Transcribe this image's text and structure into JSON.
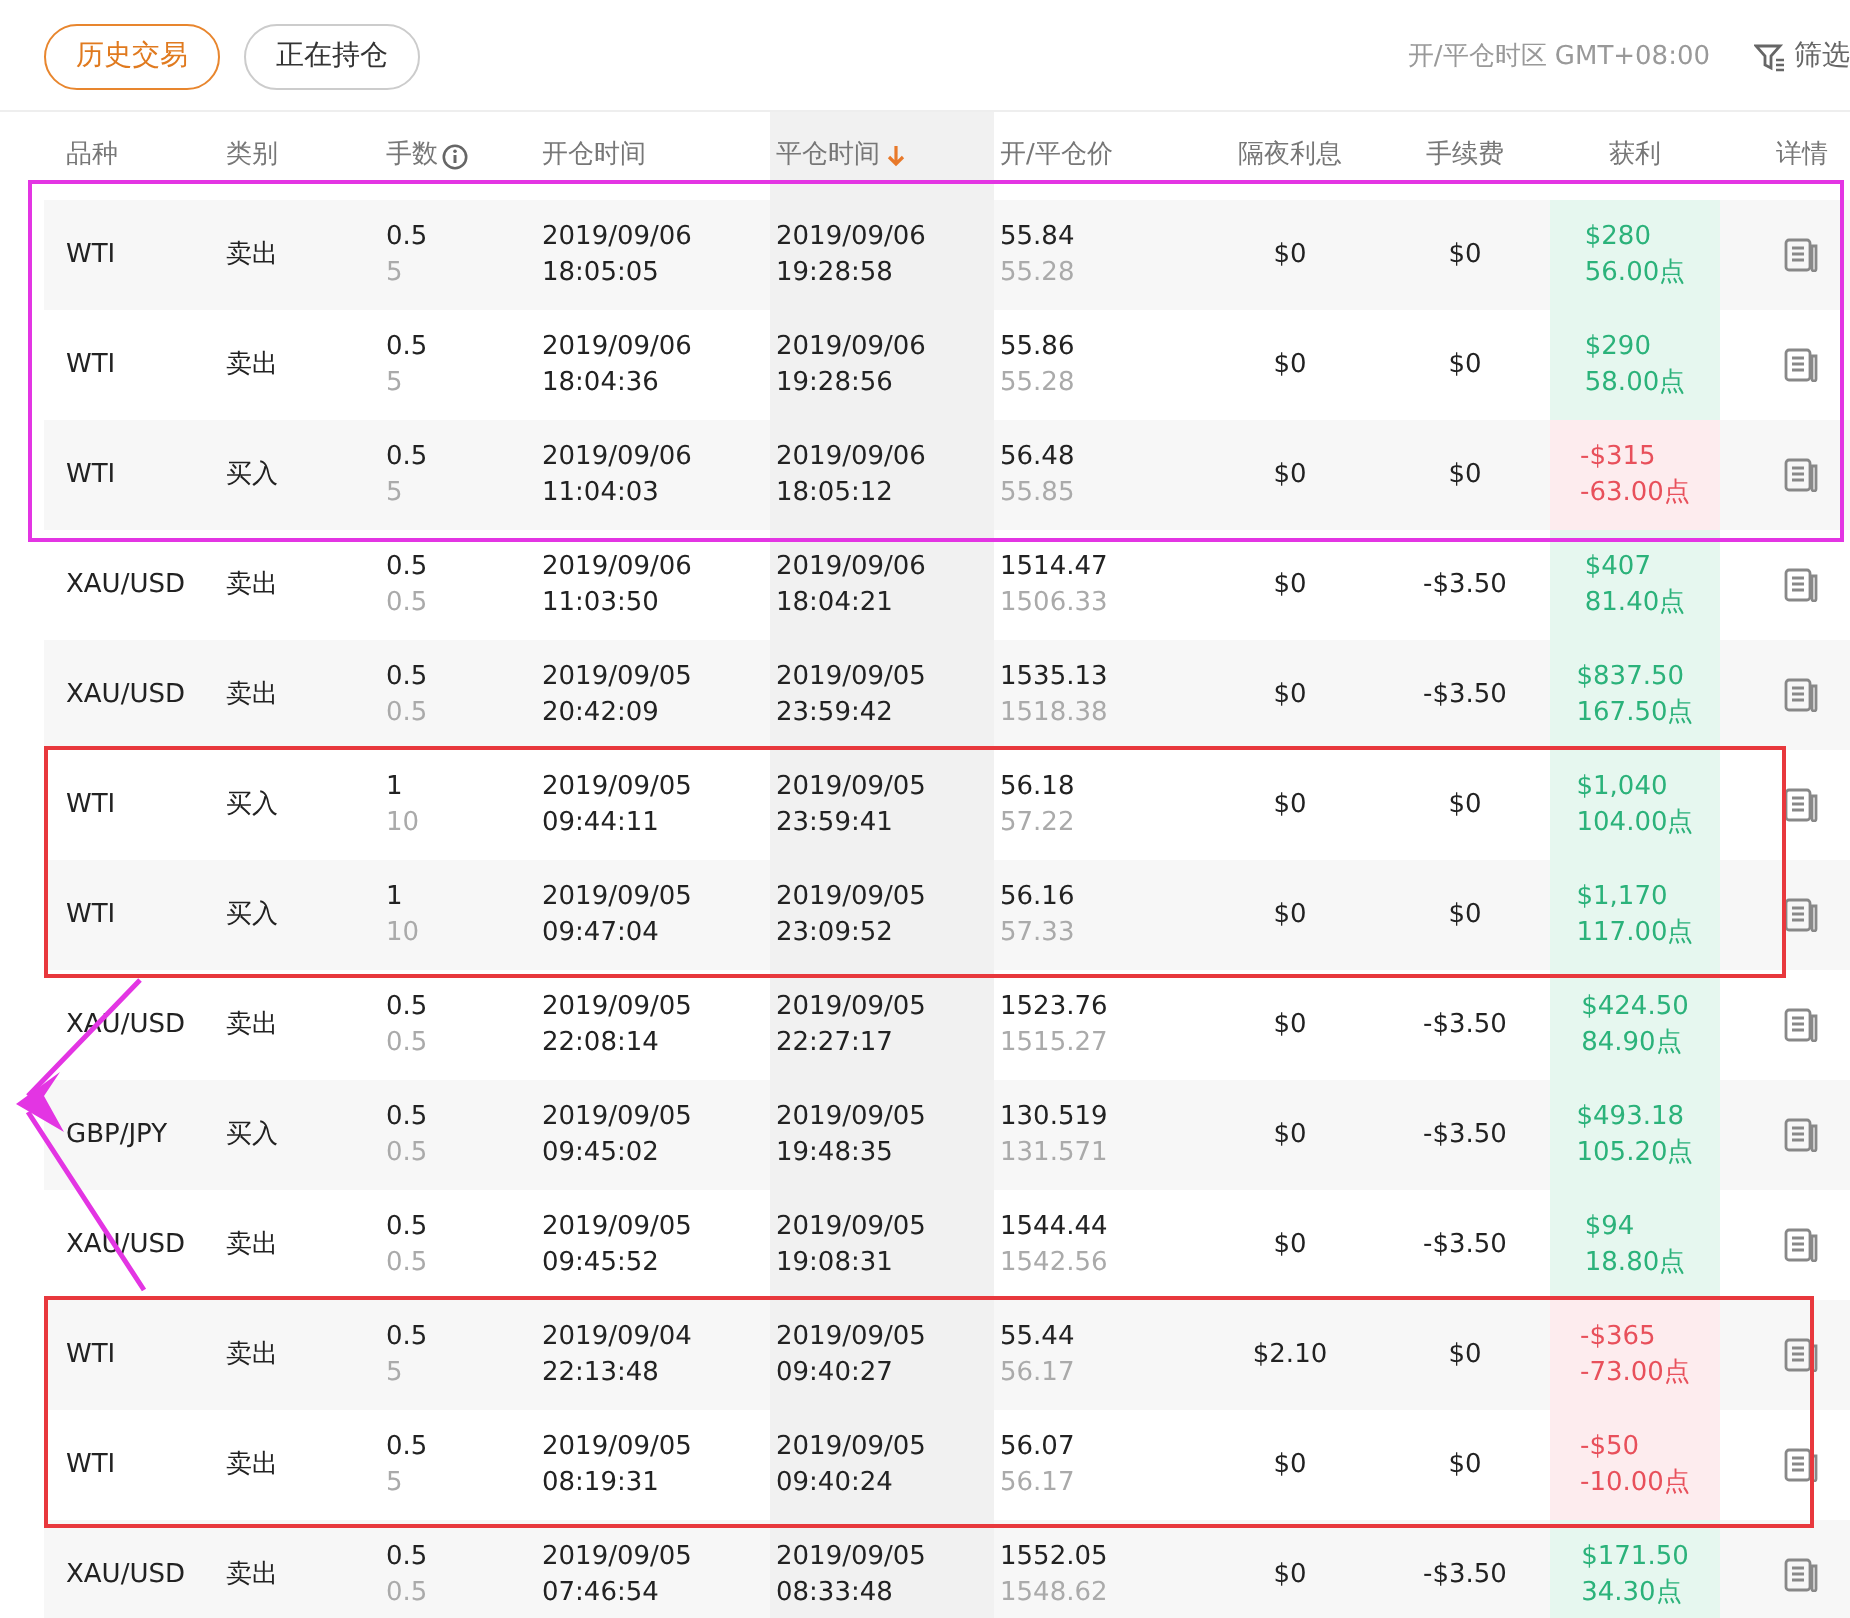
{
  "tabs": [
    {
      "label": "历史交易",
      "selected": true
    },
    {
      "label": "正在持仓",
      "selected": false
    }
  ],
  "timezone": "开/平仓时区 GMT+08:00",
  "filter": {
    "label": "筛选"
  },
  "columns": [
    {
      "label": "品种",
      "sorted": false
    },
    {
      "label": "类别",
      "sorted": false
    },
    {
      "label": "手数",
      "sorted": false,
      "info": true
    },
    {
      "label": "开仓时间",
      "sorted": false
    },
    {
      "label": "平仓时间",
      "sorted": true
    },
    {
      "label": "开/平仓价",
      "sorted": false
    },
    {
      "label": "隔夜利息",
      "sorted": false
    },
    {
      "label": "手续费",
      "sorted": false
    },
    {
      "label": "获利",
      "sorted": false
    },
    {
      "label": "详情",
      "sorted": false
    }
  ],
  "rows": [
    {
      "symbol": "WTI",
      "side": "卖出",
      "lots": "0.5",
      "units": "5",
      "open_date": "2019/09/06",
      "open_time": "18:05:05",
      "close_date": "2019/09/06",
      "close_time": "19:28:58",
      "open_price": "55.84",
      "close_price": "55.28",
      "swap": "$0",
      "fee": "$0",
      "profit": "$280",
      "points": "56.00点",
      "kind": "gain",
      "color": "#e335e3"
    },
    {
      "symbol": "WTI",
      "side": "卖出",
      "lots": "0.5",
      "units": "5",
      "open_date": "2019/09/06",
      "open_time": "18:04:36",
      "close_date": "2019/09/06",
      "close_time": "19:28:56",
      "open_price": "55.86",
      "close_price": "55.28",
      "swap": "$0",
      "fee": "$0",
      "profit": "$290",
      "points": "58.00点",
      "kind": "gain",
      "color": "#e335e3"
    },
    {
      "symbol": "WTI",
      "side": "买入",
      "lots": "0.5",
      "units": "5",
      "open_date": "2019/09/06",
      "open_time": "11:04:03",
      "close_date": "2019/09/06",
      "close_time": "18:05:12",
      "open_price": "56.48",
      "close_price": "55.85",
      "swap": "$0",
      "fee": "$0",
      "profit": "-$315",
      "points": "-63.00点",
      "kind": "loss",
      "color": "#e335e3"
    },
    {
      "symbol": "XAU/USD",
      "side": "卖出",
      "lots": "0.5",
      "units": "0.5",
      "open_date": "2019/09/06",
      "open_time": "11:03:50",
      "close_date": "2019/09/06",
      "close_time": "18:04:21",
      "open_price": "1514.47",
      "close_price": "1506.33",
      "swap": "$0",
      "fee": "-$3.50",
      "profit": "$407",
      "points": "81.40点",
      "kind": "gain"
    },
    {
      "symbol": "XAU/USD",
      "side": "卖出",
      "lots": "0.5",
      "units": "0.5",
      "open_date": "2019/09/05",
      "open_time": "20:42:09",
      "close_date": "2019/09/05",
      "close_time": "23:59:42",
      "open_price": "1535.13",
      "close_price": "1518.38",
      "swap": "$0",
      "fee": "-$3.50",
      "profit": "$837.50",
      "points": "167.50点",
      "kind": "gain"
    },
    {
      "symbol": "WTI",
      "side": "买入",
      "lots": "1",
      "units": "10",
      "open_date": "2019/09/05",
      "open_time": "09:44:11",
      "close_date": "2019/09/05",
      "close_time": "23:59:41",
      "open_price": "56.18",
      "close_price": "57.22",
      "swap": "$0",
      "fee": "$0",
      "profit": "$1,040",
      "points": "104.00点",
      "kind": "gain",
      "color": "#e8383d"
    },
    {
      "symbol": "WTI",
      "side": "买入",
      "lots": "1",
      "units": "10",
      "open_date": "2019/09/05",
      "open_time": "09:47:04",
      "close_date": "2019/09/05",
      "close_time": "23:09:52",
      "open_price": "56.16",
      "close_price": "57.33",
      "swap": "$0",
      "fee": "$0",
      "profit": "$1,170",
      "points": "117.00点",
      "kind": "gain",
      "color": "#e8383d"
    },
    {
      "symbol": "XAU/USD",
      "side": "卖出",
      "lots": "0.5",
      "units": "0.5",
      "open_date": "2019/09/05",
      "open_time": "22:08:14",
      "close_date": "2019/09/05",
      "close_time": "22:27:17",
      "open_price": "1523.76",
      "close_price": "1515.27",
      "swap": "$0",
      "fee": "-$3.50",
      "profit": "$424.50",
      "points": "84.90点",
      "kind": "gain"
    },
    {
      "symbol": "GBP/JPY",
      "side": "买入",
      "lots": "0.5",
      "units": "0.5",
      "open_date": "2019/09/05",
      "open_time": "09:45:02",
      "close_date": "2019/09/05",
      "close_time": "19:48:35",
      "open_price": "130.519",
      "close_price": "131.571",
      "swap": "$0",
      "fee": "-$3.50",
      "profit": "$493.18",
      "points": "105.20点",
      "kind": "gain"
    },
    {
      "symbol": "XAU/USD",
      "side": "卖出",
      "lots": "0.5",
      "units": "0.5",
      "open_date": "2019/09/05",
      "open_time": "09:45:52",
      "close_date": "2019/09/05",
      "close_time": "19:08:31",
      "open_price": "1544.44",
      "close_price": "1542.56",
      "swap": "$0",
      "fee": "-$3.50",
      "profit": "$94",
      "points": "18.80点",
      "kind": "gain"
    },
    {
      "symbol": "WTI",
      "side": "卖出",
      "lots": "0.5",
      "units": "5",
      "open_date": "2019/09/04",
      "open_time": "22:13:48",
      "close_date": "2019/09/05",
      "close_time": "09:40:27",
      "open_price": "55.44",
      "close_price": "56.17",
      "swap": "$2.10",
      "fee": "$0",
      "profit": "-$365",
      "points": "-73.00点",
      "kind": "loss",
      "color": "#e8383d"
    },
    {
      "symbol": "WTI",
      "side": "卖出",
      "lots": "0.5",
      "units": "5",
      "open_date": "2019/09/05",
      "open_time": "08:19:31",
      "close_date": "2019/09/05",
      "close_time": "09:40:24",
      "open_price": "56.07",
      "close_price": "56.17",
      "swap": "$0",
      "fee": "$0",
      "profit": "-$50",
      "points": "-10.00点",
      "kind": "loss",
      "color": "#e8383d"
    },
    {
      "symbol": "XAU/USD",
      "side": "卖出",
      "lots": "0.5",
      "units": "0.5",
      "open_date": "2019/09/05",
      "open_time": "07:46:54",
      "close_date": "2019/09/05",
      "close_time": "08:33:48",
      "open_price": "1552.05",
      "close_price": "1548.62",
      "swap": "$0",
      "fee": "-$3.50",
      "profit": "$171.50",
      "points": "34.30点",
      "kind": "gain"
    }
  ],
  "pointer_arrow": {
    "color": "#e335e3"
  }
}
